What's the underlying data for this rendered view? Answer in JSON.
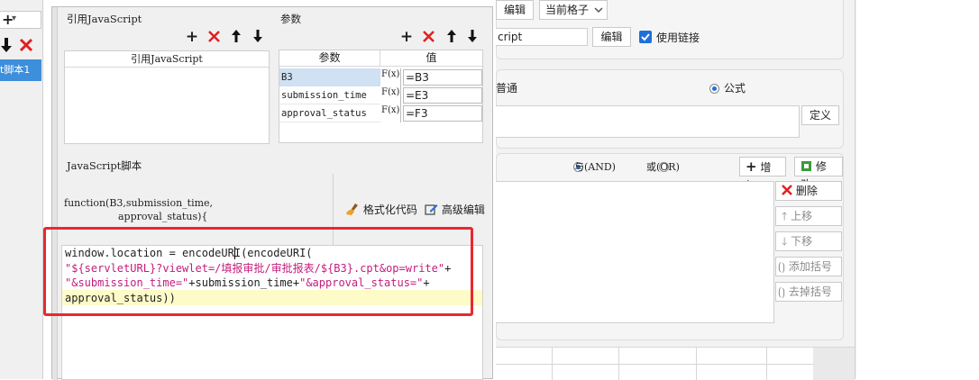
{
  "left_panel": {
    "toolbar_add": "+",
    "toolbar_caret": "▾",
    "item_label": "t脚本1"
  },
  "right_panel": {
    "top_edit_button": "编辑",
    "cell_select_value": "当前格子",
    "link_input_value": "cript",
    "link_edit_button": "编辑",
    "use_link_label": "使用链接",
    "radio_normal_label": "普通",
    "radio_formula_label": "公式",
    "define_button": "定义",
    "radio_and_label": "与(AND)",
    "radio_or_label": "或(OR)",
    "add_button": "增加",
    "modify_button": "修改",
    "delete_button": "删除",
    "move_up_button": "上移",
    "move_down_button": "下移",
    "add_bracket_button": "添加括号",
    "remove_bracket_button": "去掉括号"
  },
  "dialog": {
    "js_ref_section_title": "引用JavaScript",
    "js_ref_column": "引用JavaScript",
    "params_section_title": "参数",
    "params_columns": {
      "param": "参数",
      "value": "值"
    },
    "params": [
      {
        "name": "B3",
        "value": "=B3"
      },
      {
        "name": "submission_time",
        "value": "=E3"
      },
      {
        "name": "approval_status",
        "value": "=F3"
      }
    ],
    "formula_icon": "F(x)",
    "script_section_title": "JavaScript脚本",
    "function_signature_line1": "function(B3,submission_time,",
    "function_signature_line2": "approval_status){",
    "format_code_button": "格式化代码",
    "advanced_edit_button": "高级编辑",
    "code": {
      "line1_plain": "window.location = encodeURI(encodeURI(",
      "line2_string": "\"${servletURL}?viewlet=/填报审批/审批报表/${B3}.cpt&op=write\"",
      "line2_plus": "+",
      "line3_string1": "\"&submission_time=\"",
      "line3_mid": "+submission_time+",
      "line3_string2": "\"&approval_status=\"",
      "line3_plus": "+",
      "line4": "approval_status))"
    }
  },
  "colors": {
    "accent_blue": "#3d8edb",
    "highlight_red": "#e8282e",
    "code_string": "#c21d7c",
    "current_line": "#fdfbc8"
  }
}
